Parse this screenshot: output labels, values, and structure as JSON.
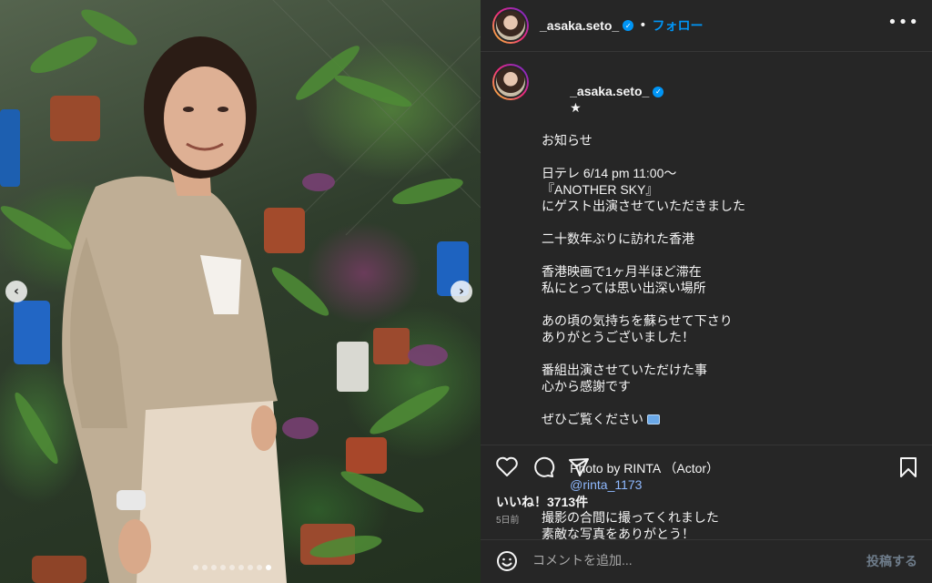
{
  "post": {
    "username": "_asaka.seto_",
    "verified_badge": "✓",
    "separator": "•",
    "follow_label": "フォロー",
    "more_label": "•••",
    "caption_star": "★",
    "caption_lines": [
      "お知らせ",
      "",
      "日テレ 6/14 pm 11:00〜",
      "『ANOTHER SKY』",
      "にゲスト出演させていただきました",
      "",
      "二十数年ぶりに訪れた香港",
      "",
      "香港映画で1ヶ月半ほど滞在",
      "私にとっては思い出深い場所",
      "",
      "あの頃の気持ちを蘇らせて下さり",
      "ありがとうございました！",
      "",
      "番組出演させていただけた事",
      "心から感謝です",
      "",
      "ぜひご覧ください"
    ],
    "photo_credit": "Photo by RINTA （Actor）",
    "mention": "@rinta_1173",
    "caption_tail": [
      "撮影の合間に撮ってくれました",
      "素敵な写真をありがとう！"
    ],
    "likes": "いいね！3713件",
    "time": "5日前",
    "comment_placeholder": "コメントを追加...",
    "post_label": "投稿する"
  },
  "carousel": {
    "prev_label": "‹",
    "next_label": "›",
    "dot_count": 9,
    "active_dot": 8
  },
  "colors": {
    "panel_bg": "#262626",
    "accent": "#0095f6",
    "mention": "#8fb9ff"
  },
  "icons": [
    "heart-icon",
    "comment-icon",
    "share-icon",
    "bookmark-icon",
    "emoji-icon",
    "verified-icon",
    "more-icon"
  ]
}
